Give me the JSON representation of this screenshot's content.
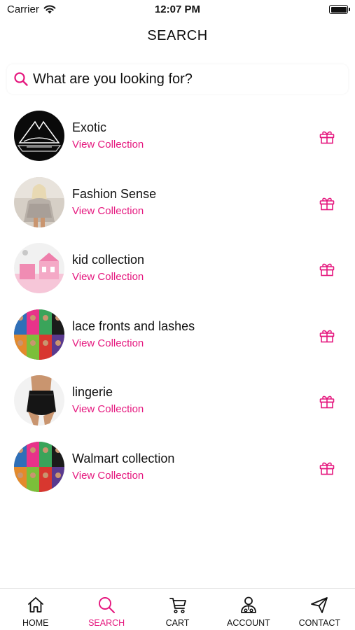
{
  "status_bar": {
    "carrier": "Carrier",
    "time": "12:07 PM"
  },
  "header": {
    "title": "SEARCH"
  },
  "search": {
    "placeholder": "What are you looking for?"
  },
  "collections": [
    {
      "name": "Exotic",
      "link": "View Collection"
    },
    {
      "name": "Fashion Sense",
      "link": "View Collection"
    },
    {
      "name": "kid collection",
      "link": "View Collection"
    },
    {
      "name": "lace fronts and lashes",
      "link": "View Collection"
    },
    {
      "name": "lingerie",
      "link": "View Collection"
    },
    {
      "name": "Walmart collection",
      "link": "View Collection"
    }
  ],
  "tabs": [
    {
      "label": "HOME",
      "icon": "home-icon"
    },
    {
      "label": "SEARCH",
      "icon": "search-icon",
      "active": true
    },
    {
      "label": "CART",
      "icon": "cart-icon"
    },
    {
      "label": "ACCOUNT",
      "icon": "account-icon"
    },
    {
      "label": "CONTACT",
      "icon": "send-icon"
    }
  ],
  "colors": {
    "accent": "#e5177e",
    "text": "#111111",
    "background": "#ffffff"
  }
}
